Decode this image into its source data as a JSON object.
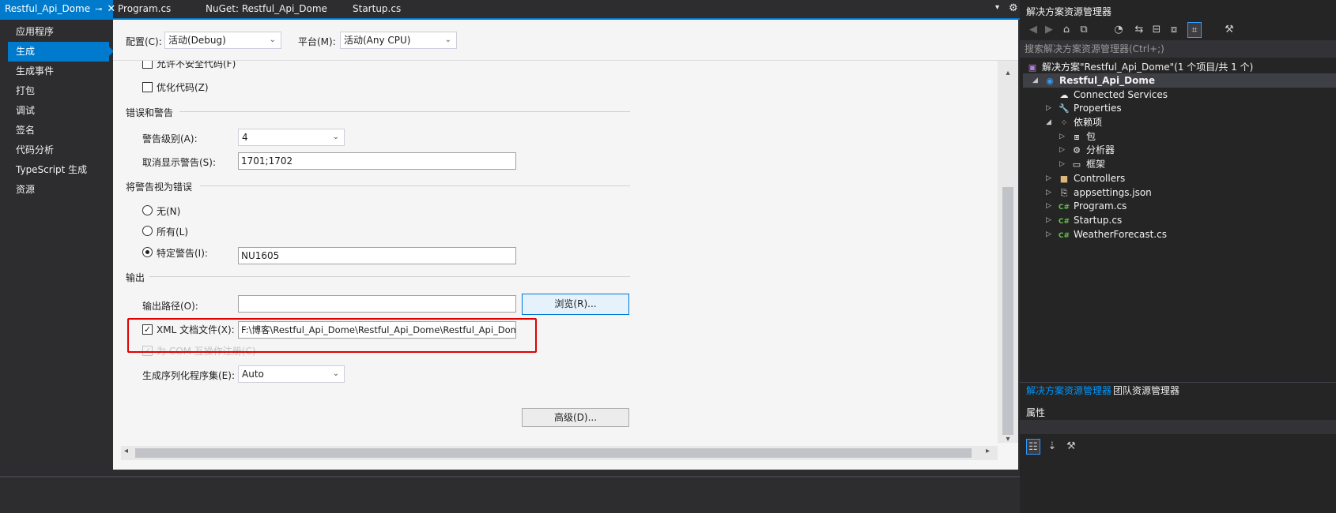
{
  "tabs": [
    {
      "label": "Restful_Api_Dome",
      "active": true
    },
    {
      "label": "Program.cs",
      "active": false
    },
    {
      "label": "NuGet: Restful_Api_Dome",
      "active": false
    },
    {
      "label": "Startup.cs",
      "active": false
    }
  ],
  "tab_icons": {
    "pin": "⊸",
    "close": "✕",
    "dropdown": "▾",
    "gear": "⚙"
  },
  "nav": {
    "items": [
      {
        "label": "应用程序"
      },
      {
        "label": "生成",
        "active": true
      },
      {
        "label": "生成事件"
      },
      {
        "label": "打包"
      },
      {
        "label": "调试"
      },
      {
        "label": "签名"
      },
      {
        "label": "代码分析"
      },
      {
        "label": "TypeScript 生成"
      },
      {
        "label": "资源"
      }
    ]
  },
  "config": {
    "config_label": "配置(C):",
    "config_value": "活动(Debug)",
    "platform_label": "平台(M):",
    "platform_value": "活动(Any CPU)"
  },
  "general": {
    "unsafe_label": "允许不安全代码(F)",
    "optimize_label": "优化代码(Z)"
  },
  "errors": {
    "section": "错误和警告",
    "warning_level_label": "警告级别(A):",
    "warning_level_value": "4",
    "suppress_label": "取消显示警告(S):",
    "suppress_value": "1701;1702"
  },
  "treat": {
    "section": "将警告视为错误",
    "none_label": "无(N)",
    "all_label": "所有(L)",
    "specific_label": "特定警告(I):",
    "specific_value": "NU1605",
    "selected": "specific"
  },
  "output": {
    "section": "输出",
    "path_label": "输出路径(O):",
    "path_value": "",
    "browse_label": "浏览(R)...",
    "xml_label": "XML 文档文件(X):",
    "xml_checked": true,
    "xml_value": "F:\\博客\\Restful_Api_Dome\\Restful_Api_Dome\\Restful_Api_Dome.xml",
    "com_label": "为 COM 互操作注册(C)",
    "serialization_label": "生成序列化程序集(E):",
    "serialization_value": "Auto",
    "advanced_label": "高级(D)..."
  },
  "solution": {
    "title": "解决方案资源管理器",
    "search_placeholder": "搜索解决方案资源管理器(Ctrl+;)",
    "tree": [
      {
        "label": "解决方案\"Restful_Api_Dome\"(1 个项目/共 1 个)",
        "icon": "sln"
      },
      {
        "label": "Restful_Api_Dome",
        "icon": "proj"
      },
      {
        "label": "Connected Services",
        "icon": "cloud"
      },
      {
        "label": "Properties",
        "icon": "wrench"
      },
      {
        "label": "依赖项",
        "icon": "deps"
      },
      {
        "label": "包",
        "icon": "pkg"
      },
      {
        "label": "分析器",
        "icon": "analyzer"
      },
      {
        "label": "框架",
        "icon": "framework"
      },
      {
        "label": "Controllers",
        "icon": "folder"
      },
      {
        "label": "appsettings.json",
        "icon": "json"
      },
      {
        "label": "Program.cs",
        "icon": "cs"
      },
      {
        "label": "Startup.cs",
        "icon": "cs"
      },
      {
        "label": "WeatherForecast.cs",
        "icon": "cs"
      }
    ],
    "tab_solution": "解决方案资源管理器",
    "tab_team": "团队资源管理器",
    "props_title": "属性",
    "cs_badge": "C#"
  },
  "icons": {
    "check": "✓",
    "chevron_down": "⌄",
    "arrow_up": "▴",
    "arrow_down": "▾",
    "arrow_left": "◂",
    "arrow_right": "▸",
    "expanded": "◢",
    "collapsed": "▷"
  }
}
